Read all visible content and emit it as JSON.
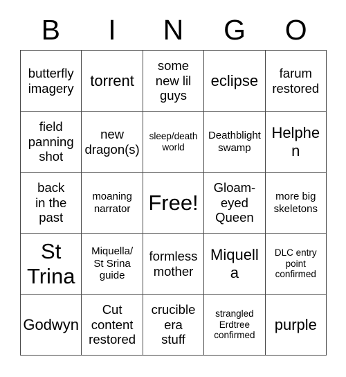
{
  "header": {
    "letters": [
      "B",
      "I",
      "N",
      "G",
      "O"
    ]
  },
  "grid": {
    "rows": 5,
    "columns": 5,
    "border_color": "#4a4a4a",
    "background_color": "#ffffff",
    "text_color": "#000000",
    "cells": [
      {
        "text": "butterfly imagery",
        "size": "md"
      },
      {
        "text": "torrent",
        "size": "lg"
      },
      {
        "text": "some\nnew lil\nguys",
        "size": "md"
      },
      {
        "text": "eclipse",
        "size": "lg"
      },
      {
        "text": "farum restored",
        "size": "md"
      },
      {
        "text": "field\npanning\nshot",
        "size": "md"
      },
      {
        "text": "new\ndragon(s)",
        "size": "md"
      },
      {
        "text": "sleep/death world",
        "size": "xs"
      },
      {
        "text": "Deathblight swamp",
        "size": "sm"
      },
      {
        "text": "Helphen",
        "size": "lg"
      },
      {
        "text": "back\nin the\npast",
        "size": "md"
      },
      {
        "text": "moaning narrator",
        "size": "sm"
      },
      {
        "text": "Free!",
        "size": "xxl"
      },
      {
        "text": "Gloam-\neyed\nQueen",
        "size": "md"
      },
      {
        "text": "more big skeletons",
        "size": "sm"
      },
      {
        "text": "St\nTrina",
        "size": "xxl"
      },
      {
        "text": "Miquella/\nSt Srina\nguide",
        "size": "sm"
      },
      {
        "text": "formless mother",
        "size": "md"
      },
      {
        "text": "Miquella",
        "size": "lg"
      },
      {
        "text": "DLC entry\npoint\nconfirmed",
        "size": "xs"
      },
      {
        "text": "Godwyn",
        "size": "lg"
      },
      {
        "text": "Cut\ncontent\nrestored",
        "size": "md"
      },
      {
        "text": "crucible\nera\nstuff",
        "size": "md"
      },
      {
        "text": "strangled\nErdtree\nconfirmed",
        "size": "xs"
      },
      {
        "text": "purple",
        "size": "lg"
      }
    ]
  }
}
